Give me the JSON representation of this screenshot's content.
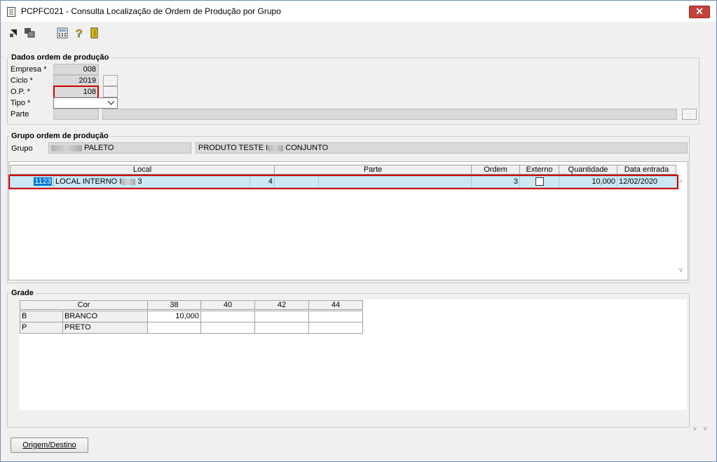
{
  "window": {
    "title": "PCPFC021 - Consulta Localização de Ordem de Produção por Grupo",
    "close_glyph": "✕"
  },
  "toolbar": {
    "icons": [
      "arrow-icon",
      "multi-window-icon",
      "calculator-icon",
      "help-icon",
      "exit-door-icon"
    ]
  },
  "dados": {
    "title": "Dados ordem de produção",
    "empresa_label": "Empresa *",
    "empresa_value": "008",
    "ciclo_label": "Ciclo *",
    "ciclo_value": "2019",
    "op_label": "O.P. *",
    "op_value": "108",
    "tipo_label": "Tipo *",
    "tipo_value": "",
    "parte_label": "Parte",
    "parte_value": "",
    "parte_desc": ""
  },
  "grupo": {
    "title": "Grupo ordem de produção",
    "grupo_label": "Grupo",
    "grupo_code_suffix": "PALETO",
    "produto_prefix": "PRODUTO TESTE I",
    "produto_suffix": "CONJUNTO"
  },
  "locais": {
    "columns": {
      "local": "Local",
      "parte": "Parte",
      "ordem": "Ordem",
      "externo": "Externo",
      "quantidade": "Quantidade",
      "data_entrada": "Data entrada"
    },
    "rows": [
      {
        "code": "1123",
        "name_prefix": "LOCAL INTERNO I",
        "name_suffix": "3",
        "local_num": "4",
        "parte": "",
        "parte_desc": "",
        "ordem": "3",
        "externo": false,
        "quantidade": "10,000",
        "data_entrada": "12/02/2020"
      }
    ]
  },
  "grade": {
    "title": "Grade",
    "cor_header": "Cor",
    "sizes": [
      "38",
      "40",
      "42",
      "44"
    ],
    "rows": [
      {
        "code": "B",
        "name": "BRANCO",
        "values": [
          "10,000",
          "",
          "",
          ""
        ]
      },
      {
        "code": "P",
        "name": "PRETO",
        "values": [
          "",
          "",
          "",
          ""
        ]
      }
    ]
  },
  "footer": {
    "origem_button": "Origem/Destino"
  },
  "colors": {
    "selection": "#cce8f4",
    "highlight_code": "#0078d7",
    "red_annotation": "#d00000"
  }
}
